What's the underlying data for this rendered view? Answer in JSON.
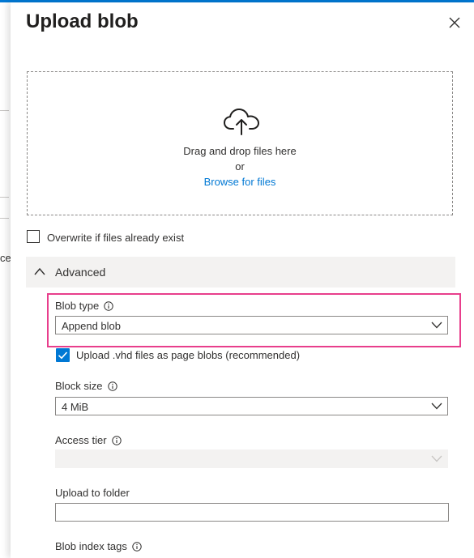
{
  "panel": {
    "title": "Upload blob",
    "close_icon": "close-icon"
  },
  "background": {
    "partial_text": "ce"
  },
  "dropzone": {
    "icon": "cloud-upload-icon",
    "drag_text": "Drag and drop files here",
    "or_text": "or",
    "browse_link": "Browse for files"
  },
  "overwrite": {
    "label": "Overwrite if files already exist",
    "checked": false
  },
  "advanced": {
    "label": "Advanced",
    "expanded": true
  },
  "blob_type": {
    "label": "Blob type",
    "value": "Append blob"
  },
  "vhd_option": {
    "label": "Upload .vhd files as page blobs (recommended)",
    "checked": true
  },
  "block_size": {
    "label": "Block size",
    "value": "4 MiB"
  },
  "access_tier": {
    "label": "Access tier",
    "value": "",
    "disabled": true
  },
  "upload_folder": {
    "label": "Upload to folder",
    "value": ""
  },
  "blob_index_tags": {
    "label": "Blob index tags"
  },
  "colors": {
    "accent": "#0078d4",
    "highlight": "#e83e8c"
  }
}
